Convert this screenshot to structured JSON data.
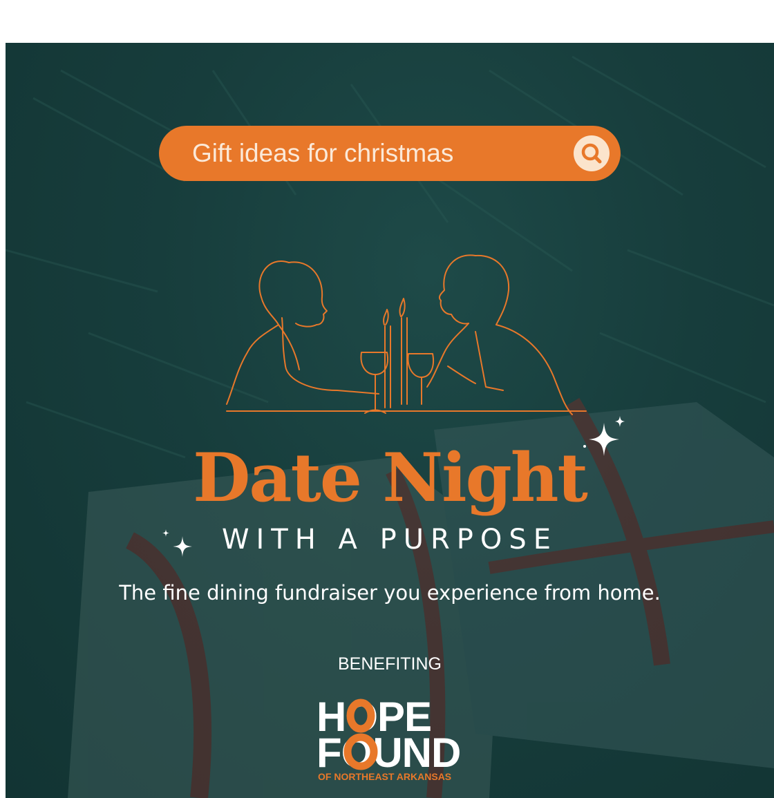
{
  "search": {
    "placeholder": "Gift ideas for christmas",
    "icon": "search-icon"
  },
  "colors": {
    "accent": "#e8782a",
    "background": "#173d3c",
    "text": "#ffffff"
  },
  "headline": {
    "title": "Date Night",
    "subtitle": "WITH A PURPOSE"
  },
  "tagline": "The fine dining fundraiser you experience from home.",
  "benefiting": "BENEFITING",
  "logo": {
    "line1": "HOPE",
    "line2": "FOUND",
    "line3": "OF NORTHEAST ARKANSAS"
  }
}
